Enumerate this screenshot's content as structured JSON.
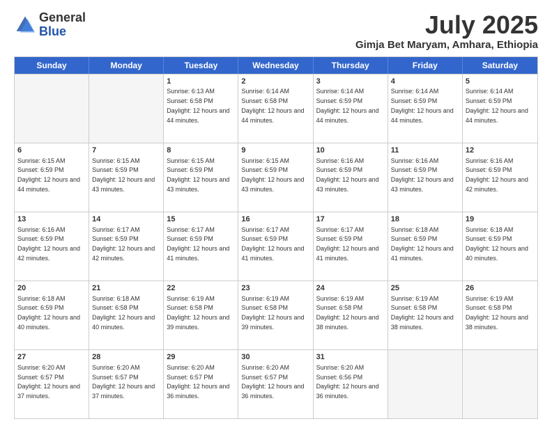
{
  "logo": {
    "general": "General",
    "blue": "Blue"
  },
  "header": {
    "month": "July 2025",
    "location": "Gimja Bet Maryam, Amhara, Ethiopia"
  },
  "days": [
    "Sunday",
    "Monday",
    "Tuesday",
    "Wednesday",
    "Thursday",
    "Friday",
    "Saturday"
  ],
  "weeks": [
    [
      {
        "day": "",
        "empty": true
      },
      {
        "day": "",
        "empty": true
      },
      {
        "day": "1",
        "sunrise": "6:13 AM",
        "sunset": "6:58 PM",
        "daylight": "12 hours and 44 minutes."
      },
      {
        "day": "2",
        "sunrise": "6:14 AM",
        "sunset": "6:58 PM",
        "daylight": "12 hours and 44 minutes."
      },
      {
        "day": "3",
        "sunrise": "6:14 AM",
        "sunset": "6:59 PM",
        "daylight": "12 hours and 44 minutes."
      },
      {
        "day": "4",
        "sunrise": "6:14 AM",
        "sunset": "6:59 PM",
        "daylight": "12 hours and 44 minutes."
      },
      {
        "day": "5",
        "sunrise": "6:14 AM",
        "sunset": "6:59 PM",
        "daylight": "12 hours and 44 minutes."
      }
    ],
    [
      {
        "day": "6",
        "sunrise": "6:15 AM",
        "sunset": "6:59 PM",
        "daylight": "12 hours and 44 minutes."
      },
      {
        "day": "7",
        "sunrise": "6:15 AM",
        "sunset": "6:59 PM",
        "daylight": "12 hours and 43 minutes."
      },
      {
        "day": "8",
        "sunrise": "6:15 AM",
        "sunset": "6:59 PM",
        "daylight": "12 hours and 43 minutes."
      },
      {
        "day": "9",
        "sunrise": "6:15 AM",
        "sunset": "6:59 PM",
        "daylight": "12 hours and 43 minutes."
      },
      {
        "day": "10",
        "sunrise": "6:16 AM",
        "sunset": "6:59 PM",
        "daylight": "12 hours and 43 minutes."
      },
      {
        "day": "11",
        "sunrise": "6:16 AM",
        "sunset": "6:59 PM",
        "daylight": "12 hours and 43 minutes."
      },
      {
        "day": "12",
        "sunrise": "6:16 AM",
        "sunset": "6:59 PM",
        "daylight": "12 hours and 42 minutes."
      }
    ],
    [
      {
        "day": "13",
        "sunrise": "6:16 AM",
        "sunset": "6:59 PM",
        "daylight": "12 hours and 42 minutes."
      },
      {
        "day": "14",
        "sunrise": "6:17 AM",
        "sunset": "6:59 PM",
        "daylight": "12 hours and 42 minutes."
      },
      {
        "day": "15",
        "sunrise": "6:17 AM",
        "sunset": "6:59 PM",
        "daylight": "12 hours and 41 minutes."
      },
      {
        "day": "16",
        "sunrise": "6:17 AM",
        "sunset": "6:59 PM",
        "daylight": "12 hours and 41 minutes."
      },
      {
        "day": "17",
        "sunrise": "6:17 AM",
        "sunset": "6:59 PM",
        "daylight": "12 hours and 41 minutes."
      },
      {
        "day": "18",
        "sunrise": "6:18 AM",
        "sunset": "6:59 PM",
        "daylight": "12 hours and 41 minutes."
      },
      {
        "day": "19",
        "sunrise": "6:18 AM",
        "sunset": "6:59 PM",
        "daylight": "12 hours and 40 minutes."
      }
    ],
    [
      {
        "day": "20",
        "sunrise": "6:18 AM",
        "sunset": "6:59 PM",
        "daylight": "12 hours and 40 minutes."
      },
      {
        "day": "21",
        "sunrise": "6:18 AM",
        "sunset": "6:58 PM",
        "daylight": "12 hours and 40 minutes."
      },
      {
        "day": "22",
        "sunrise": "6:19 AM",
        "sunset": "6:58 PM",
        "daylight": "12 hours and 39 minutes."
      },
      {
        "day": "23",
        "sunrise": "6:19 AM",
        "sunset": "6:58 PM",
        "daylight": "12 hours and 39 minutes."
      },
      {
        "day": "24",
        "sunrise": "6:19 AM",
        "sunset": "6:58 PM",
        "daylight": "12 hours and 38 minutes."
      },
      {
        "day": "25",
        "sunrise": "6:19 AM",
        "sunset": "6:58 PM",
        "daylight": "12 hours and 38 minutes."
      },
      {
        "day": "26",
        "sunrise": "6:19 AM",
        "sunset": "6:58 PM",
        "daylight": "12 hours and 38 minutes."
      }
    ],
    [
      {
        "day": "27",
        "sunrise": "6:20 AM",
        "sunset": "6:57 PM",
        "daylight": "12 hours and 37 minutes."
      },
      {
        "day": "28",
        "sunrise": "6:20 AM",
        "sunset": "6:57 PM",
        "daylight": "12 hours and 37 minutes."
      },
      {
        "day": "29",
        "sunrise": "6:20 AM",
        "sunset": "6:57 PM",
        "daylight": "12 hours and 36 minutes."
      },
      {
        "day": "30",
        "sunrise": "6:20 AM",
        "sunset": "6:57 PM",
        "daylight": "12 hours and 36 minutes."
      },
      {
        "day": "31",
        "sunrise": "6:20 AM",
        "sunset": "6:56 PM",
        "daylight": "12 hours and 36 minutes."
      },
      {
        "day": "",
        "empty": true
      },
      {
        "day": "",
        "empty": true
      }
    ]
  ]
}
